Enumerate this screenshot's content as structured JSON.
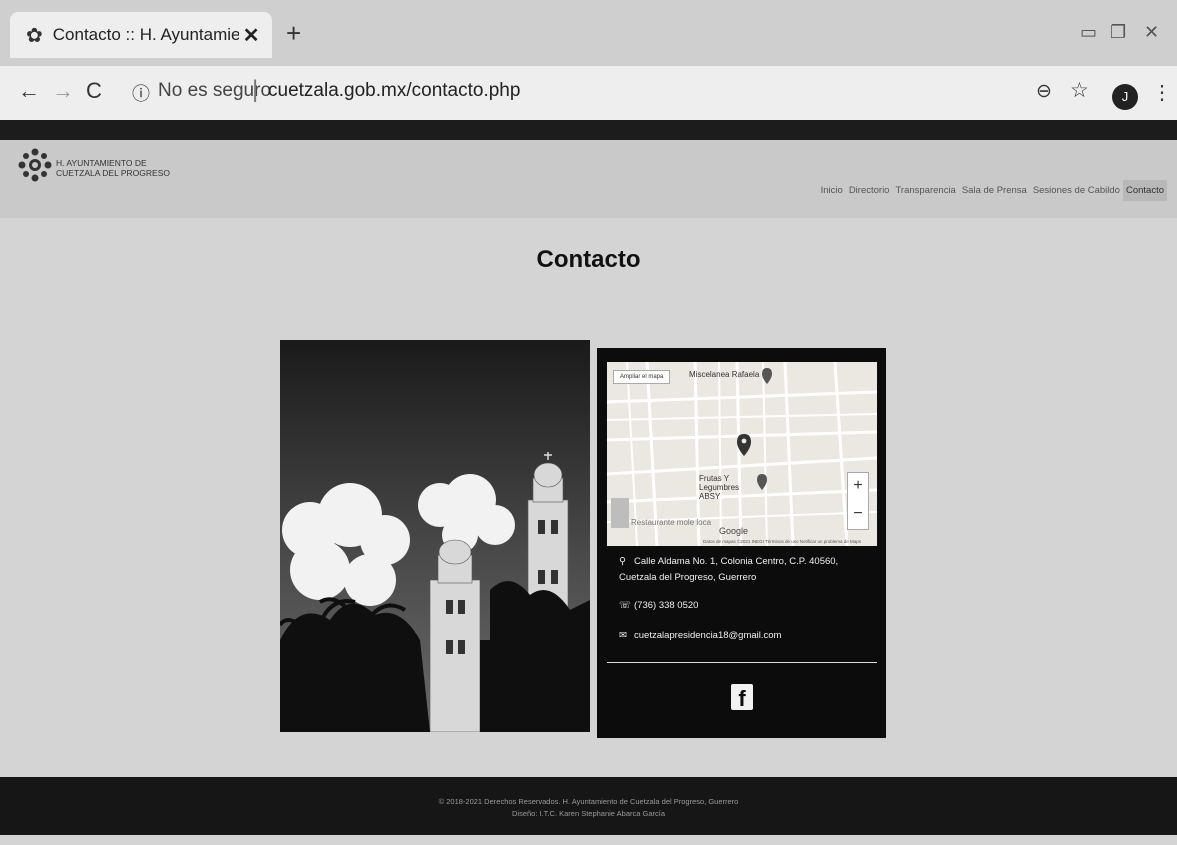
{
  "browser": {
    "tab": {
      "title": "Contacto :: H. Ayuntamiento de C",
      "favicon": "ornament-icon",
      "close_label": "✕"
    },
    "new_tab_label": "+",
    "window_controls": [
      "minimize-icon",
      "restore-icon",
      "close-icon"
    ],
    "security_label": "No es seguro",
    "url": "cuetzala.gob.mx/contacto.php",
    "profile_initial": "J"
  },
  "site": {
    "logo_line1": "H. AYUNTAMIENTO DE",
    "logo_line2": "CUETZALA DEL PROGRESO",
    "nav": [
      {
        "label": "Inicio",
        "active": false
      },
      {
        "label": "Directorio",
        "active": false
      },
      {
        "label": "Transparencia",
        "active": false
      },
      {
        "label": "Sala de Prensa",
        "active": false
      },
      {
        "label": "Sesiones de Cabildo",
        "active": false
      },
      {
        "label": "Contacto",
        "active": true
      }
    ]
  },
  "main": {
    "title": "Contacto",
    "map": {
      "enlarge_label": "Ampliar el mapa",
      "places": [
        "Miscelanea Rafaela",
        "Frutas Y Legumbres ABSY",
        "Restaurante mole loca"
      ],
      "google_label": "Google",
      "zoom_in": "+",
      "zoom_out": "−",
      "attribution": "Datos de mapas ©2021 INEGI   Términos de uso   Notificar un problema de Maps"
    },
    "contact": {
      "address": "Calle Aldama No. 1, Colonia Centro, C.P. 40560, Cuetzala del Progreso, Guerrero",
      "phone": "(736) 338 0520",
      "email": "cuetzalapresidencia18@gmail.com"
    }
  },
  "footer": {
    "line1": "© 2018-2021 Derechos Reservados. H. Ayuntamiento de Cuetzala del Progreso, Guerrero",
    "line2": "Diseño: I.T.C. Karen Stephanie Abarca García"
  }
}
